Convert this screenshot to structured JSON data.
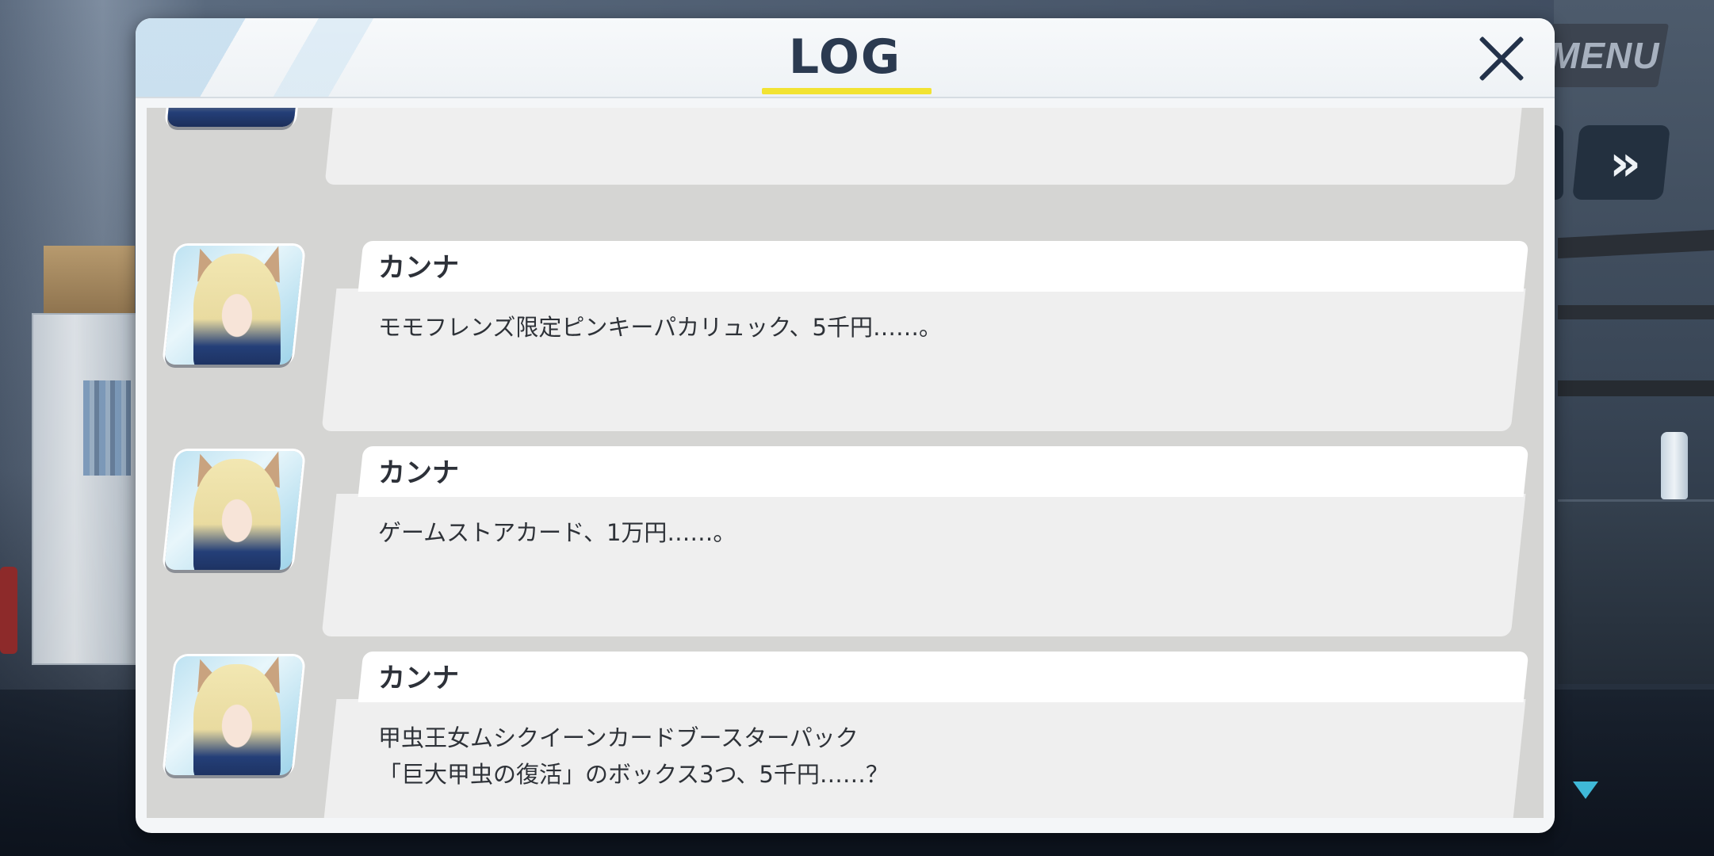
{
  "hud": {
    "menu_label": "MENU",
    "skip_glyph": "»"
  },
  "log": {
    "title": "LOG",
    "entries": [
      {
        "speaker": "カンナ",
        "text": "モモフレンズ限定ピンキーパカリュック、5千円……。"
      },
      {
        "speaker": "カンナ",
        "text": "ゲームストアカード、1万円……。"
      },
      {
        "speaker": "カンナ",
        "text": "甲虫王女ムシクイーンカードブースターパック\n「巨大甲虫の復活」のボックス3つ、5千円……？"
      }
    ]
  },
  "colors": {
    "title_text": "#2b3a50",
    "title_underline": "#f2e332",
    "close_icon": "#23324a",
    "next_indicator": "#3fb8d7"
  },
  "icons": {
    "close": "close-icon",
    "skip": "fast-forward-icon",
    "next": "triangle-down-icon"
  }
}
